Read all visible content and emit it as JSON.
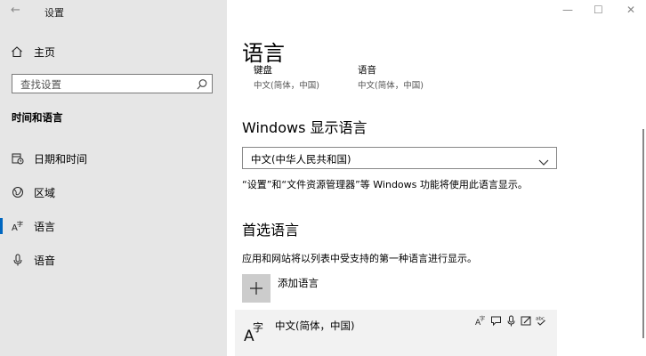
{
  "window": {
    "title": "设置",
    "back_glyph": "←",
    "minimize_glyph": "—",
    "maximize_glyph": "☐",
    "close_glyph": "✕"
  },
  "sidebar": {
    "home_label": "主页",
    "search_placeholder": "查找设置",
    "section_title": "时间和语言",
    "items": [
      {
        "label": "日期和时间",
        "icon": "calendar-clock-icon",
        "selected": false
      },
      {
        "label": "区域",
        "icon": "globe-icon",
        "selected": false
      },
      {
        "label": "语言",
        "icon": "language-icon",
        "selected": true
      },
      {
        "label": "语音",
        "icon": "microphone-icon",
        "selected": false
      }
    ]
  },
  "main": {
    "page_title": "语言",
    "quick": [
      {
        "label": "键盘",
        "sub": "中文(简体，中国)"
      },
      {
        "label": "语音",
        "sub": "中文(简体，中国)"
      }
    ],
    "display_language": {
      "heading": "Windows 显示语言",
      "selected": "中文(中华人民共和国)",
      "description": "“设置”和“文件资源管理器”等 Windows 功能将使用此语言显示。"
    },
    "preferred": {
      "heading": "首选语言",
      "description": "应用和网站将以列表中受支持的第一种语言进行显示。",
      "add_button_glyph": "+",
      "add_label": "添加语言",
      "languages": [
        {
          "name": "中文(简体，中国)",
          "icon_glyph": "A字"
        }
      ]
    }
  },
  "colors": {
    "accent": "#0067c0",
    "sidebar_bg": "#e6e6e6",
    "card_bg": "#f2f2f2"
  }
}
